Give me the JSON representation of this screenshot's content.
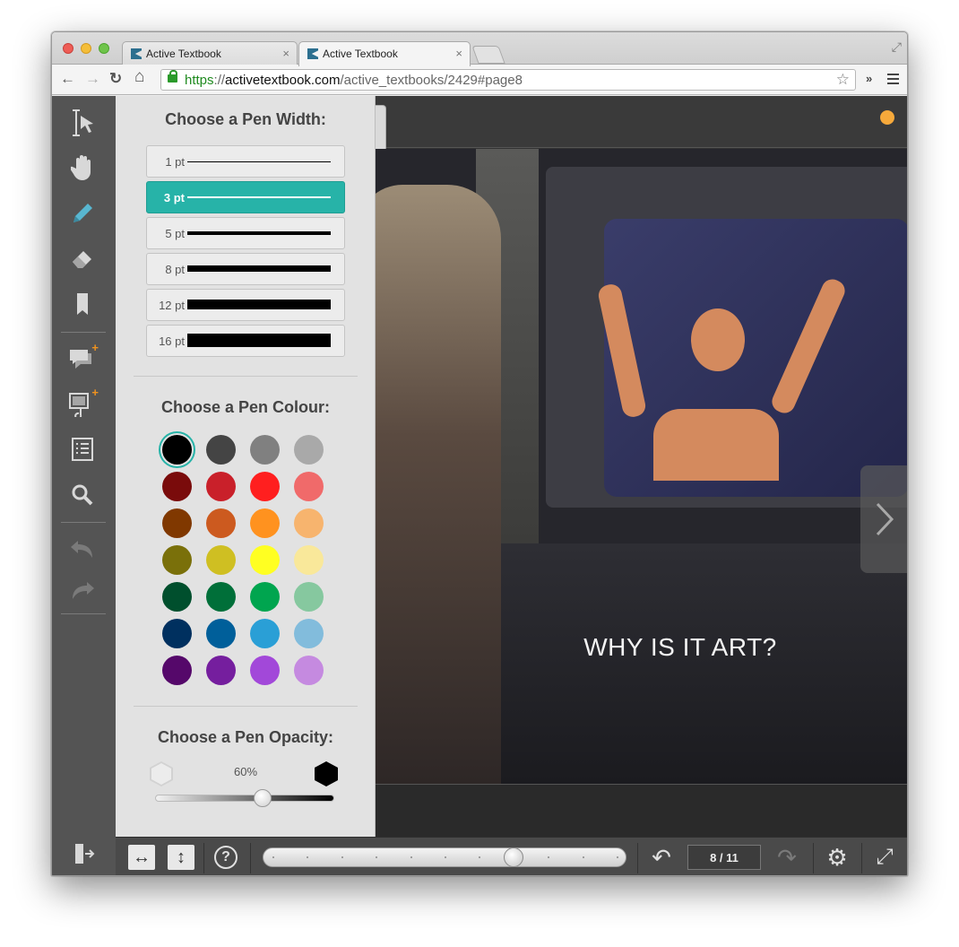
{
  "browser": {
    "tabs": [
      {
        "title": "Active Textbook",
        "active": false
      },
      {
        "title": "Active Textbook",
        "active": true
      }
    ],
    "url": {
      "scheme": "https",
      "separator": "://",
      "host": "activetextbook.com",
      "path": "/active_textbooks/2429#page8"
    },
    "nav_icons": {
      "back": "←",
      "forward": "→",
      "reload": "↻",
      "home": "⌂",
      "star": "☆",
      "extensions": "»",
      "restore": "⤢",
      "tab_close": "×"
    }
  },
  "tools": {
    "select": "selection-tool-icon",
    "hand": "hand-tool-icon",
    "pen": "pen-tool-icon",
    "eraser": "eraser-icon",
    "bookmark": "bookmark-icon",
    "add_comment": "add-comment-icon",
    "add_media": "add-media-icon",
    "contents": "table-of-contents-icon",
    "search": "search-icon",
    "undo": "undo-icon",
    "redo": "redo-icon",
    "exit": "exit-icon",
    "accent_color": "#58b6d0",
    "badge_color": "#f0931f"
  },
  "pen_panel": {
    "width_title": "Choose a Pen Width:",
    "widths": [
      {
        "label": "1 pt",
        "selected": false
      },
      {
        "label": "3 pt",
        "selected": true
      },
      {
        "label": "5 pt",
        "selected": false
      },
      {
        "label": "8 pt",
        "selected": false
      },
      {
        "label": "12 pt",
        "selected": false
      },
      {
        "label": "16 pt",
        "selected": false
      }
    ],
    "colour_title": "Choose a Pen Colour:",
    "colours": [
      [
        "#000000",
        "#444444",
        "#808080",
        "#a9a9a9"
      ],
      [
        "#7a0b0b",
        "#c9202a",
        "#ff1f1f",
        "#f06a6a"
      ],
      [
        "#803800",
        "#cc5a1f",
        "#ff921f",
        "#f7b46e"
      ],
      [
        "#7a700a",
        "#cfbf22",
        "#ffff22",
        "#f9e89a"
      ],
      [
        "#004f2d",
        "#006f39",
        "#00a54f",
        "#86c89f"
      ],
      [
        "#00305f",
        "#005f9a",
        "#2a9fd6",
        "#82bcdc"
      ],
      [
        "#55086a",
        "#751e9e",
        "#a248d9",
        "#c58ae0"
      ]
    ],
    "selected_colour": "#000000",
    "selected_accent": "#27b3a8",
    "opacity_title": "Choose a Pen Opacity:",
    "opacity_value": "60%",
    "opacity_fraction": 0.6
  },
  "viewer": {
    "caption": "WHY IS IT ART?",
    "status_dot_color": "#f6a93b",
    "next_icon": "chevron-right-icon"
  },
  "bottombar": {
    "fit_width": "↔",
    "fit_height": "↕",
    "help": "?",
    "undo_page": "↶",
    "redo_page": "↷",
    "settings": "⚙",
    "fullscreen": "⤢",
    "page_counter": "8 / 11",
    "current_page": 8,
    "total_pages": 11
  }
}
